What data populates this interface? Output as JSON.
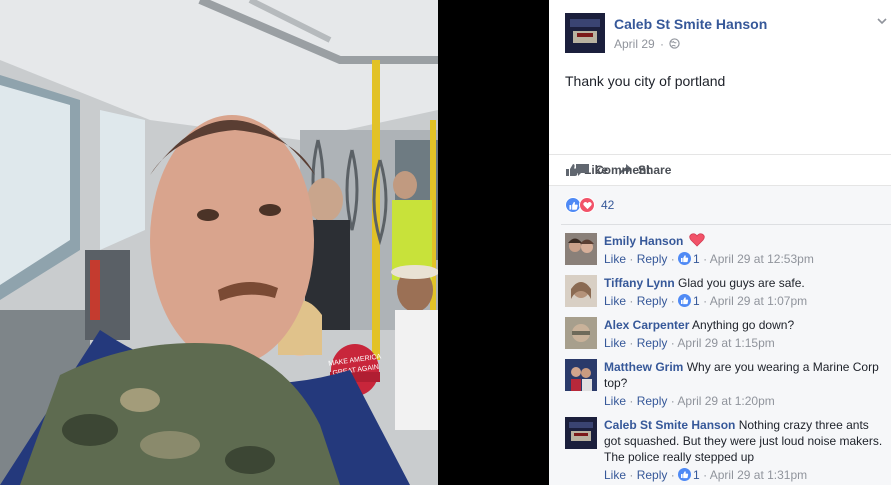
{
  "post": {
    "author": "Caleb St Smite Hanson",
    "date": "April 29",
    "date_separator": "·",
    "text": "Thank you city of portland"
  },
  "actions": {
    "like": "Like",
    "comment": "Comment",
    "share": "Share"
  },
  "reactions": {
    "count": "42"
  },
  "comments": [
    {
      "name": "Emily Hanson",
      "text": "",
      "like": "Like",
      "reply": "Reply",
      "likes": "1",
      "time": "April 29 at 12:53pm",
      "heart": true
    },
    {
      "name": "Tiffany Lynn",
      "text": "Glad you guys are safe.",
      "like": "Like",
      "reply": "Reply",
      "likes": "1",
      "time": "April 29 at 1:07pm"
    },
    {
      "name": "Alex Carpenter",
      "text": "Anything go down?",
      "like": "Like",
      "reply": "Reply",
      "likes": "",
      "time": "April 29 at 1:15pm"
    },
    {
      "name": "Matthew Grim",
      "text": "Why are you wearing a Marine Corp top?",
      "like": "Like",
      "reply": "Reply",
      "likes": "",
      "time": "April 29 at 1:20pm"
    },
    {
      "name": "Caleb St Smite Hanson",
      "text": "Nothing crazy three ants got squashed. But they were just loud noise makers. The police really stepped up",
      "like": "Like",
      "reply": "Reply",
      "likes": "1",
      "time": "April 29 at 1:31pm"
    }
  ],
  "photo": {
    "cap_text_line1": "MAKE AMERICA",
    "cap_text_line2": "GREAT AGAIN"
  },
  "colors": {
    "link": "#365899",
    "meta": "#90949c",
    "like_blue": "#4f8af5",
    "love_red": "#f25268"
  },
  "sep": " · "
}
